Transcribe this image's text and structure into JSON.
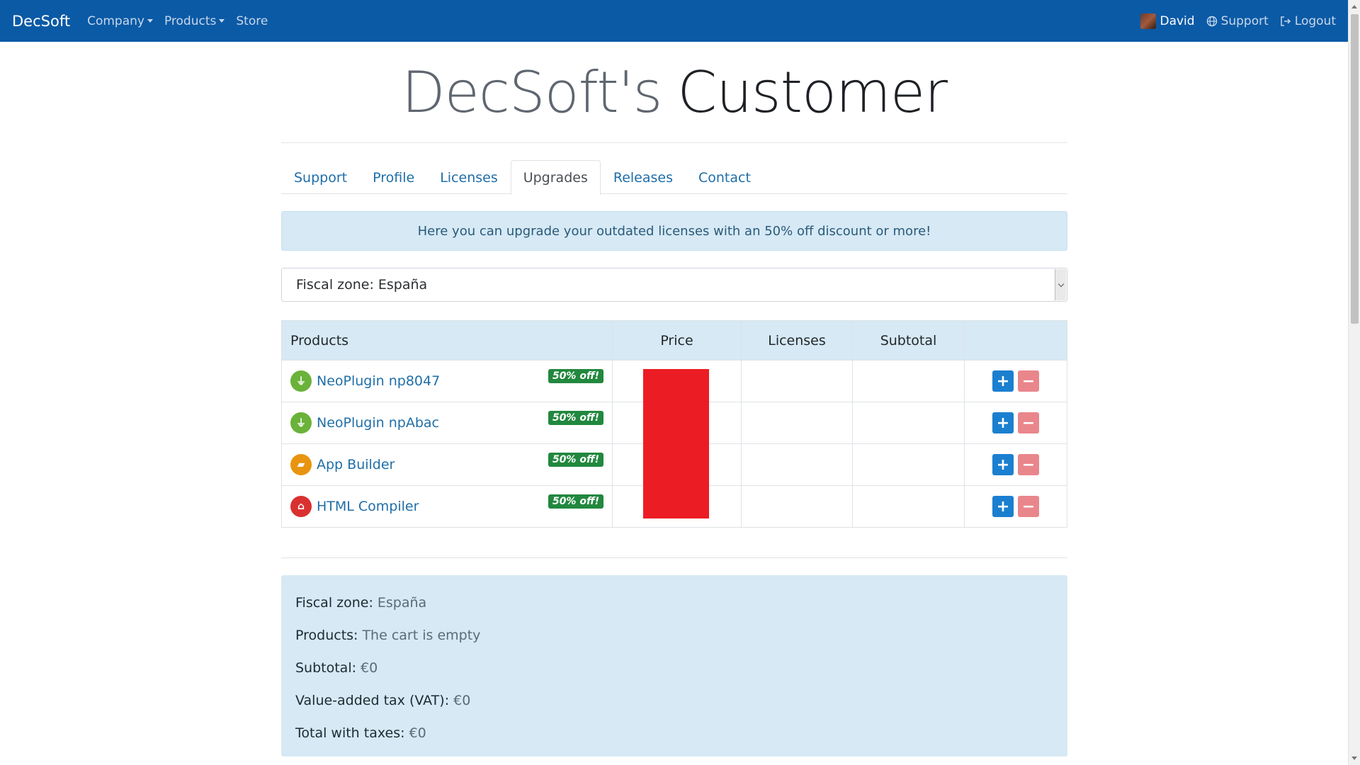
{
  "navbar": {
    "brand": "DecSoft",
    "menu": [
      {
        "label": "Company",
        "dropdown": true
      },
      {
        "label": "Products",
        "dropdown": true
      },
      {
        "label": "Store",
        "dropdown": false
      }
    ],
    "user": "David",
    "support": "Support",
    "logout": "Logout"
  },
  "hero": {
    "part1": "DecSoft's",
    "part2": "Customer"
  },
  "tabs": [
    {
      "label": "Support",
      "active": false
    },
    {
      "label": "Profile",
      "active": false
    },
    {
      "label": "Licenses",
      "active": false
    },
    {
      "label": "Upgrades",
      "active": true
    },
    {
      "label": "Releases",
      "active": false
    },
    {
      "label": "Contact",
      "active": false
    }
  ],
  "alert": "Here you can upgrade your outdated licenses with an 50% off discount or more!",
  "fiscal_select": "Fiscal zone: España",
  "table": {
    "headers": [
      "Products",
      "Price",
      "Licenses",
      "Subtotal",
      ""
    ],
    "rows": [
      {
        "name": "NeoPlugin np8047",
        "badge": "50% off!",
        "icon": "plug-icon",
        "color": "#6ab23a"
      },
      {
        "name": "NeoPlugin npAbac",
        "badge": "50% off!",
        "icon": "plug-icon",
        "color": "#6ab23a"
      },
      {
        "name": "App Builder",
        "badge": "50% off!",
        "icon": "app-builder-icon",
        "color": "#e8940f"
      },
      {
        "name": "HTML Compiler",
        "badge": "50% off!",
        "icon": "html-compiler-icon",
        "color": "#d9312f"
      }
    ],
    "plus": "+",
    "minus": "−"
  },
  "summary": {
    "fiscal_label": "Fiscal zone:",
    "fiscal_value": "España",
    "products_label": "Products:",
    "products_value": "The cart is empty",
    "subtotal_label": "Subtotal:",
    "subtotal_value": "€0",
    "vat_label": "Value-added tax (VAT):",
    "vat_value": "€0",
    "total_label": "Total with taxes:",
    "total_value": "€0"
  },
  "colors": {
    "navbar": "#0b5aa6",
    "accent": "#1b7fd0",
    "badge": "#21883e",
    "redaction": "#ec1c24"
  }
}
